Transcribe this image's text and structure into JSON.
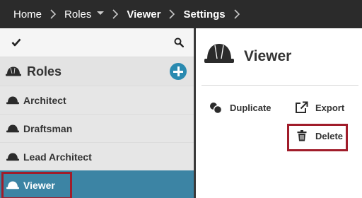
{
  "breadcrumb": {
    "home": "Home",
    "roles": "Roles",
    "viewer": "Viewer",
    "settings": "Settings"
  },
  "sidebar": {
    "section_title": "Roles",
    "items": [
      {
        "label": "Architect"
      },
      {
        "label": "Draftsman"
      },
      {
        "label": "Lead Architect"
      },
      {
        "label": "Viewer"
      }
    ]
  },
  "detail": {
    "title": "Viewer",
    "actions": {
      "duplicate": "Duplicate",
      "export": "Export",
      "delete": "Delete"
    }
  },
  "icons": {
    "check": "check-icon",
    "search": "search-icon",
    "role": "hard-hat-icon",
    "add": "plus-circle-icon",
    "duplicate": "duplicate-icon",
    "export": "external-link-icon",
    "delete": "trash-icon"
  },
  "colors": {
    "topbar": "#2b2b2b",
    "accent": "#2a8ab0",
    "selected_row": "#3c84a4",
    "highlight": "#a01c2a"
  }
}
